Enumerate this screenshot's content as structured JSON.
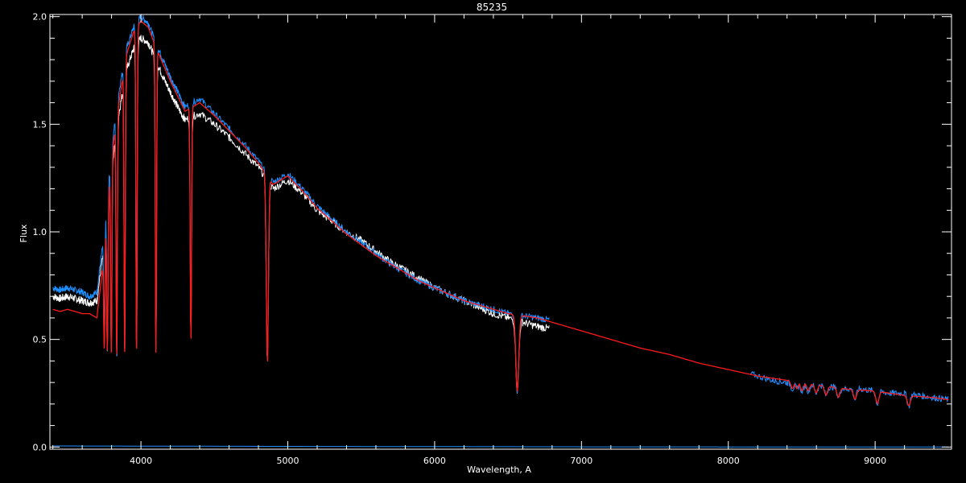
{
  "chart_data": {
    "type": "line",
    "title": "85235",
    "xlabel": "Wavelength, A",
    "ylabel": "Flux",
    "xlim": [
      3380,
      9520
    ],
    "ylim": [
      -0.01,
      2.01
    ],
    "xticks": [
      4000,
      5000,
      6000,
      7000,
      8000,
      9000
    ],
    "xtick_labels": [
      "4000",
      "5000",
      "6000",
      "7000",
      "8000",
      "9000"
    ],
    "yticks": [
      0.0,
      0.5,
      1.0,
      1.5,
      2.0
    ],
    "ytick_labels": [
      "0.0",
      "0.5",
      "1.0",
      "1.5",
      "2.0"
    ],
    "grid": false,
    "colors": {
      "background": "#000000",
      "axes": "#ffffff",
      "observed_white": "#ffffff",
      "observed_blue": "#1e90ff",
      "model": "#ff1a1a"
    },
    "series": [
      {
        "id": "observed_white",
        "color": "#ffffff",
        "x": [
          3400,
          3450,
          3500,
          3550,
          3600,
          3650,
          3700,
          3750,
          3800,
          3850,
          3900,
          3950,
          4000,
          4050,
          4100,
          4150,
          4200,
          4250,
          4300,
          4400,
          4500,
          4600,
          4700,
          4800,
          4900,
          5000,
          5100,
          5200,
          5300,
          5400,
          5500,
          5600,
          5700,
          5800,
          5900,
          6000,
          6100,
          6200,
          6300,
          6400,
          6500,
          6600,
          6700,
          6780
        ],
        "y": [
          0.7,
          0.69,
          0.7,
          0.69,
          0.68,
          0.67,
          0.68,
          0.95,
          1.3,
          1.55,
          1.75,
          1.85,
          1.9,
          1.88,
          1.8,
          1.72,
          1.65,
          1.58,
          1.52,
          1.55,
          1.5,
          1.44,
          1.37,
          1.3,
          1.2,
          1.24,
          1.18,
          1.1,
          1.05,
          1.0,
          0.96,
          0.91,
          0.86,
          0.82,
          0.78,
          0.74,
          0.71,
          0.68,
          0.65,
          0.62,
          0.6,
          0.58,
          0.56,
          0.55
        ]
      },
      {
        "id": "observed_blue",
        "color": "#1e90ff",
        "x": [
          3400,
          3450,
          3500,
          3550,
          3600,
          3650,
          3700,
          3750,
          3800,
          3850,
          3900,
          3950,
          4000,
          4050,
          4100,
          4150,
          4200,
          4250,
          4300,
          4400,
          4500,
          4600,
          4700,
          4800,
          4900,
          5000,
          5100,
          5200,
          5300,
          5400,
          5500,
          5600,
          5700,
          5800,
          5900,
          6000,
          6100,
          6200,
          6300,
          6400,
          6500,
          6600,
          6700,
          6780,
          8150,
          8300,
          8400,
          8500,
          8600,
          8700,
          8800,
          8900,
          9000,
          9100,
          9200,
          9300,
          9400,
          9500
        ],
        "y": [
          0.74,
          0.73,
          0.74,
          0.73,
          0.72,
          0.7,
          0.72,
          1.0,
          1.4,
          1.65,
          1.85,
          1.95,
          2.0,
          1.97,
          1.88,
          1.8,
          1.72,
          1.65,
          1.58,
          1.62,
          1.55,
          1.48,
          1.41,
          1.33,
          1.23,
          1.27,
          1.2,
          1.12,
          1.06,
          1.0,
          0.95,
          0.9,
          0.85,
          0.81,
          0.77,
          0.74,
          0.71,
          0.68,
          0.66,
          0.64,
          0.62,
          0.61,
          0.6,
          0.59,
          0.34,
          0.31,
          0.3,
          0.29,
          0.29,
          0.28,
          0.27,
          0.27,
          0.26,
          0.25,
          0.25,
          0.24,
          0.23,
          0.22
        ]
      },
      {
        "id": "model",
        "color": "#ff1a1a",
        "x": [
          3400,
          3450,
          3500,
          3550,
          3600,
          3650,
          3700,
          3750,
          3800,
          3850,
          3900,
          3950,
          4000,
          4050,
          4100,
          4150,
          4200,
          4250,
          4300,
          4400,
          4500,
          4600,
          4700,
          4800,
          4900,
          5000,
          5100,
          5200,
          5300,
          5400,
          5500,
          5600,
          5700,
          5800,
          5900,
          6000,
          6100,
          6200,
          6300,
          6400,
          6500,
          6600,
          6700,
          6800,
          7000,
          7200,
          7400,
          7600,
          7800,
          8000,
          8200,
          8400,
          8600,
          8800,
          9000,
          9200,
          9400,
          9500
        ],
        "y": [
          0.64,
          0.63,
          0.64,
          0.63,
          0.62,
          0.62,
          0.6,
          0.9,
          1.35,
          1.6,
          1.82,
          1.93,
          1.98,
          1.95,
          1.86,
          1.78,
          1.7,
          1.63,
          1.56,
          1.6,
          1.54,
          1.47,
          1.4,
          1.32,
          1.22,
          1.26,
          1.19,
          1.11,
          1.05,
          0.99,
          0.94,
          0.89,
          0.85,
          0.81,
          0.77,
          0.74,
          0.71,
          0.68,
          0.66,
          0.64,
          0.62,
          0.61,
          0.6,
          0.58,
          0.54,
          0.5,
          0.46,
          0.43,
          0.39,
          0.36,
          0.33,
          0.31,
          0.29,
          0.27,
          0.26,
          0.24,
          0.23,
          0.22
        ]
      },
      {
        "id": "baseline",
        "color": "#1e90ff",
        "x": [
          3400,
          5000,
          6000,
          7000,
          9500
        ],
        "y": [
          0.005,
          0.003,
          0.002,
          0.001,
          0.0
        ]
      }
    ],
    "absorption_lines": {
      "balmer": [
        {
          "x": 3750,
          "depth": 0.46
        },
        {
          "x": 3771,
          "depth": 0.45
        },
        {
          "x": 3798,
          "depth": 0.44
        },
        {
          "x": 3835,
          "depth": 0.43
        },
        {
          "x": 3889,
          "depth": 0.43
        },
        {
          "x": 3970,
          "depth": 0.43
        },
        {
          "x": 4102,
          "depth": 0.44
        },
        {
          "x": 4340,
          "depth": 0.42
        },
        {
          "x": 4861,
          "depth": 0.38
        },
        {
          "x": 6563,
          "depth": 0.26
        }
      ],
      "paschen": [
        {
          "x": 8437,
          "depth": 0.27
        },
        {
          "x": 8467,
          "depth": 0.27
        },
        {
          "x": 8502,
          "depth": 0.26
        },
        {
          "x": 8545,
          "depth": 0.26
        },
        {
          "x": 8598,
          "depth": 0.25
        },
        {
          "x": 8665,
          "depth": 0.24
        },
        {
          "x": 8750,
          "depth": 0.23
        },
        {
          "x": 8863,
          "depth": 0.22
        },
        {
          "x": 9015,
          "depth": 0.2
        },
        {
          "x": 9229,
          "depth": 0.19
        }
      ]
    }
  }
}
